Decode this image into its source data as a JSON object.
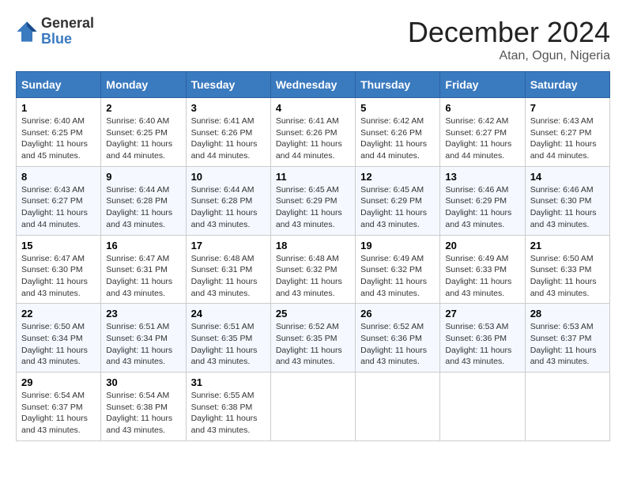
{
  "logo": {
    "general": "General",
    "blue": "Blue"
  },
  "header": {
    "month": "December 2024",
    "location": "Atan, Ogun, Nigeria"
  },
  "weekdays": [
    "Sunday",
    "Monday",
    "Tuesday",
    "Wednesday",
    "Thursday",
    "Friday",
    "Saturday"
  ],
  "weeks": [
    [
      {
        "day": "1",
        "sunrise": "6:40 AM",
        "sunset": "6:25 PM",
        "daylight": "11 hours and 45 minutes"
      },
      {
        "day": "2",
        "sunrise": "6:40 AM",
        "sunset": "6:25 PM",
        "daylight": "11 hours and 44 minutes"
      },
      {
        "day": "3",
        "sunrise": "6:41 AM",
        "sunset": "6:26 PM",
        "daylight": "11 hours and 44 minutes"
      },
      {
        "day": "4",
        "sunrise": "6:41 AM",
        "sunset": "6:26 PM",
        "daylight": "11 hours and 44 minutes"
      },
      {
        "day": "5",
        "sunrise": "6:42 AM",
        "sunset": "6:26 PM",
        "daylight": "11 hours and 44 minutes"
      },
      {
        "day": "6",
        "sunrise": "6:42 AM",
        "sunset": "6:27 PM",
        "daylight": "11 hours and 44 minutes"
      },
      {
        "day": "7",
        "sunrise": "6:43 AM",
        "sunset": "6:27 PM",
        "daylight": "11 hours and 44 minutes"
      }
    ],
    [
      {
        "day": "8",
        "sunrise": "6:43 AM",
        "sunset": "6:27 PM",
        "daylight": "11 hours and 44 minutes"
      },
      {
        "day": "9",
        "sunrise": "6:44 AM",
        "sunset": "6:28 PM",
        "daylight": "11 hours and 43 minutes"
      },
      {
        "day": "10",
        "sunrise": "6:44 AM",
        "sunset": "6:28 PM",
        "daylight": "11 hours and 43 minutes"
      },
      {
        "day": "11",
        "sunrise": "6:45 AM",
        "sunset": "6:29 PM",
        "daylight": "11 hours and 43 minutes"
      },
      {
        "day": "12",
        "sunrise": "6:45 AM",
        "sunset": "6:29 PM",
        "daylight": "11 hours and 43 minutes"
      },
      {
        "day": "13",
        "sunrise": "6:46 AM",
        "sunset": "6:29 PM",
        "daylight": "11 hours and 43 minutes"
      },
      {
        "day": "14",
        "sunrise": "6:46 AM",
        "sunset": "6:30 PM",
        "daylight": "11 hours and 43 minutes"
      }
    ],
    [
      {
        "day": "15",
        "sunrise": "6:47 AM",
        "sunset": "6:30 PM",
        "daylight": "11 hours and 43 minutes"
      },
      {
        "day": "16",
        "sunrise": "6:47 AM",
        "sunset": "6:31 PM",
        "daylight": "11 hours and 43 minutes"
      },
      {
        "day": "17",
        "sunrise": "6:48 AM",
        "sunset": "6:31 PM",
        "daylight": "11 hours and 43 minutes"
      },
      {
        "day": "18",
        "sunrise": "6:48 AM",
        "sunset": "6:32 PM",
        "daylight": "11 hours and 43 minutes"
      },
      {
        "day": "19",
        "sunrise": "6:49 AM",
        "sunset": "6:32 PM",
        "daylight": "11 hours and 43 minutes"
      },
      {
        "day": "20",
        "sunrise": "6:49 AM",
        "sunset": "6:33 PM",
        "daylight": "11 hours and 43 minutes"
      },
      {
        "day": "21",
        "sunrise": "6:50 AM",
        "sunset": "6:33 PM",
        "daylight": "11 hours and 43 minutes"
      }
    ],
    [
      {
        "day": "22",
        "sunrise": "6:50 AM",
        "sunset": "6:34 PM",
        "daylight": "11 hours and 43 minutes"
      },
      {
        "day": "23",
        "sunrise": "6:51 AM",
        "sunset": "6:34 PM",
        "daylight": "11 hours and 43 minutes"
      },
      {
        "day": "24",
        "sunrise": "6:51 AM",
        "sunset": "6:35 PM",
        "daylight": "11 hours and 43 minutes"
      },
      {
        "day": "25",
        "sunrise": "6:52 AM",
        "sunset": "6:35 PM",
        "daylight": "11 hours and 43 minutes"
      },
      {
        "day": "26",
        "sunrise": "6:52 AM",
        "sunset": "6:36 PM",
        "daylight": "11 hours and 43 minutes"
      },
      {
        "day": "27",
        "sunrise": "6:53 AM",
        "sunset": "6:36 PM",
        "daylight": "11 hours and 43 minutes"
      },
      {
        "day": "28",
        "sunrise": "6:53 AM",
        "sunset": "6:37 PM",
        "daylight": "11 hours and 43 minutes"
      }
    ],
    [
      {
        "day": "29",
        "sunrise": "6:54 AM",
        "sunset": "6:37 PM",
        "daylight": "11 hours and 43 minutes"
      },
      {
        "day": "30",
        "sunrise": "6:54 AM",
        "sunset": "6:38 PM",
        "daylight": "11 hours and 43 minutes"
      },
      {
        "day": "31",
        "sunrise": "6:55 AM",
        "sunset": "6:38 PM",
        "daylight": "11 hours and 43 minutes"
      },
      null,
      null,
      null,
      null
    ]
  ],
  "labels": {
    "sunrise": "Sunrise:",
    "sunset": "Sunset:",
    "daylight": "Daylight:"
  }
}
